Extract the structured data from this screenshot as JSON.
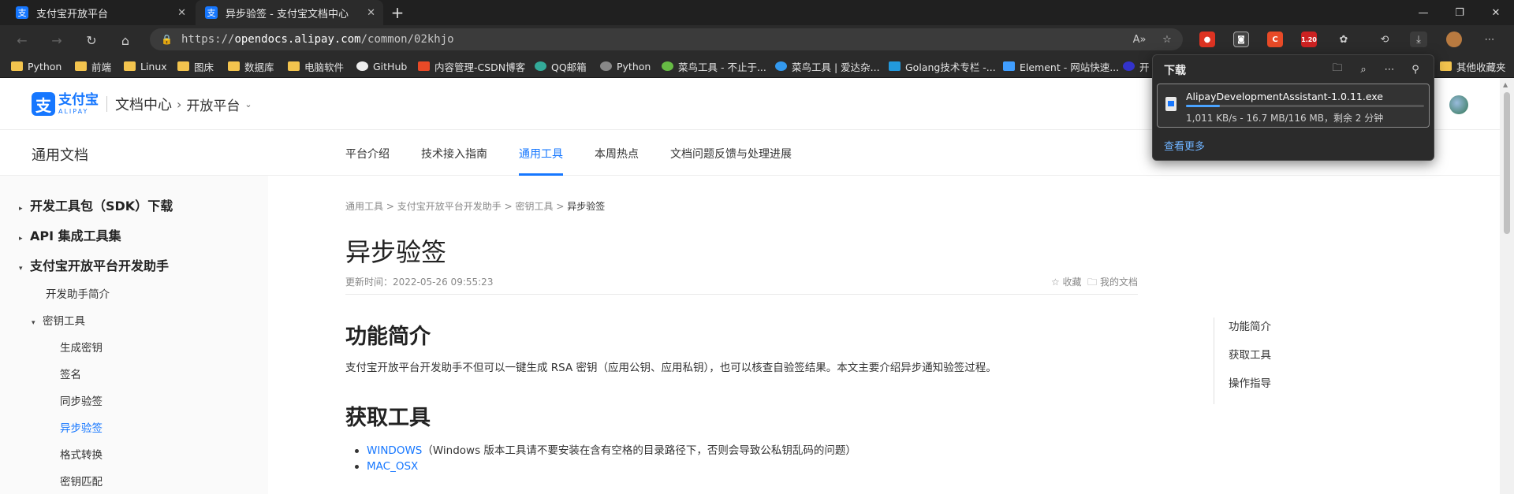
{
  "browser": {
    "tabs": [
      {
        "title": "支付宝开放平台",
        "favicon": "支"
      },
      {
        "title": "异步验签 - 支付宝文档中心",
        "favicon": "支"
      }
    ],
    "url_prefix": "https://",
    "url_host": "opendocs.alipay.com",
    "url_path": "/common/02khjo",
    "extension_badge": "1.20",
    "bookmarks": [
      {
        "label": "Python",
        "icon": "folder-icon"
      },
      {
        "label": "前端",
        "icon": "folder-icon"
      },
      {
        "label": "Linux",
        "icon": "folder-icon"
      },
      {
        "label": "图床",
        "icon": "folder-icon"
      },
      {
        "label": "数据库",
        "icon": "folder-icon"
      },
      {
        "label": "电脑软件",
        "icon": "folder-icon"
      },
      {
        "label": "GitHub",
        "icon": "github-icon"
      },
      {
        "label": "内容管理-CSDN博客",
        "icon": "csdn-icon"
      },
      {
        "label": "QQ邮箱",
        "icon": "qqmail-icon"
      },
      {
        "label": "Python",
        "icon": "python-icon"
      },
      {
        "label": "菜鸟工具 - 不止于...",
        "icon": "runoob-icon"
      },
      {
        "label": "菜鸟工具 | 爱达杂...",
        "icon": "runoob-icon"
      },
      {
        "label": "Golang技术专栏 -...",
        "icon": "golang-icon"
      },
      {
        "label": "Element - 网站快速...",
        "icon": "element-icon"
      },
      {
        "label": "开",
        "icon": "globe-icon"
      },
      {
        "label": "其他收藏夹",
        "icon": "folder-icon"
      }
    ]
  },
  "downloads": {
    "title": "下载",
    "file_name": "AlipayDevelopmentAssistant-1.0.11.exe",
    "status": "1,011 KB/s - 16.7 MB/116 MB，剩余 2 分钟",
    "progress_percent": 14.4,
    "see_more": "查看更多"
  },
  "site": {
    "logo_cn": "支付宝",
    "logo_en": "ALIPAY",
    "doc_center": "文档中心",
    "crumb_sep": "›",
    "platform": "开放平台",
    "section_title": "通用文档",
    "nav": [
      "平台介绍",
      "技术接入指南",
      "通用工具",
      "本周热点",
      "文档问题反馈与处理进展"
    ],
    "active_nav": "通用工具"
  },
  "sidebar": {
    "items": [
      {
        "label": "开发工具包（SDK）下载",
        "level": 1,
        "arrow": "▸"
      },
      {
        "label": "API 集成工具集",
        "level": 1,
        "arrow": "▸"
      },
      {
        "label": "支付宝开放平台开发助手",
        "level": 1,
        "arrow": "▾"
      },
      {
        "label": "开发助手简介",
        "level": 2
      },
      {
        "label": "密钥工具",
        "level": 2,
        "arrow": "▾"
      },
      {
        "label": "生成密钥",
        "level": 3
      },
      {
        "label": "签名",
        "level": 3
      },
      {
        "label": "同步验签",
        "level": 3
      },
      {
        "label": "异步验签",
        "level": 3,
        "active": true
      },
      {
        "label": "格式转换",
        "level": 3
      },
      {
        "label": "密钥匹配",
        "level": 3
      }
    ]
  },
  "article": {
    "breadcrumb": [
      "通用工具",
      "支付宝开放平台开发助手",
      "密钥工具",
      "异步验签"
    ],
    "breadcrumb_sep": ">",
    "title": "异步验签",
    "updated": "更新时间：2022-05-26 09:55:23",
    "favorite": "☆ 收藏",
    "my_docs": "🗀 我的文档",
    "section1": "功能简介",
    "section1_text": "支付宝开放平台开发助手不但可以一键生成 RSA 密钥（应用公钥、应用私钥），也可以核查自验签结果。本文主要介绍异步通知验签过程。",
    "section2": "获取工具",
    "link1": "WINDOWS",
    "link1_note": "（Windows 版本工具请不要安装在含有空格的目录路径下，否则会导致公私钥乱码的问题）",
    "link2": "MAC_OSX"
  },
  "toc": [
    "功能简介",
    "获取工具",
    "操作指导"
  ]
}
